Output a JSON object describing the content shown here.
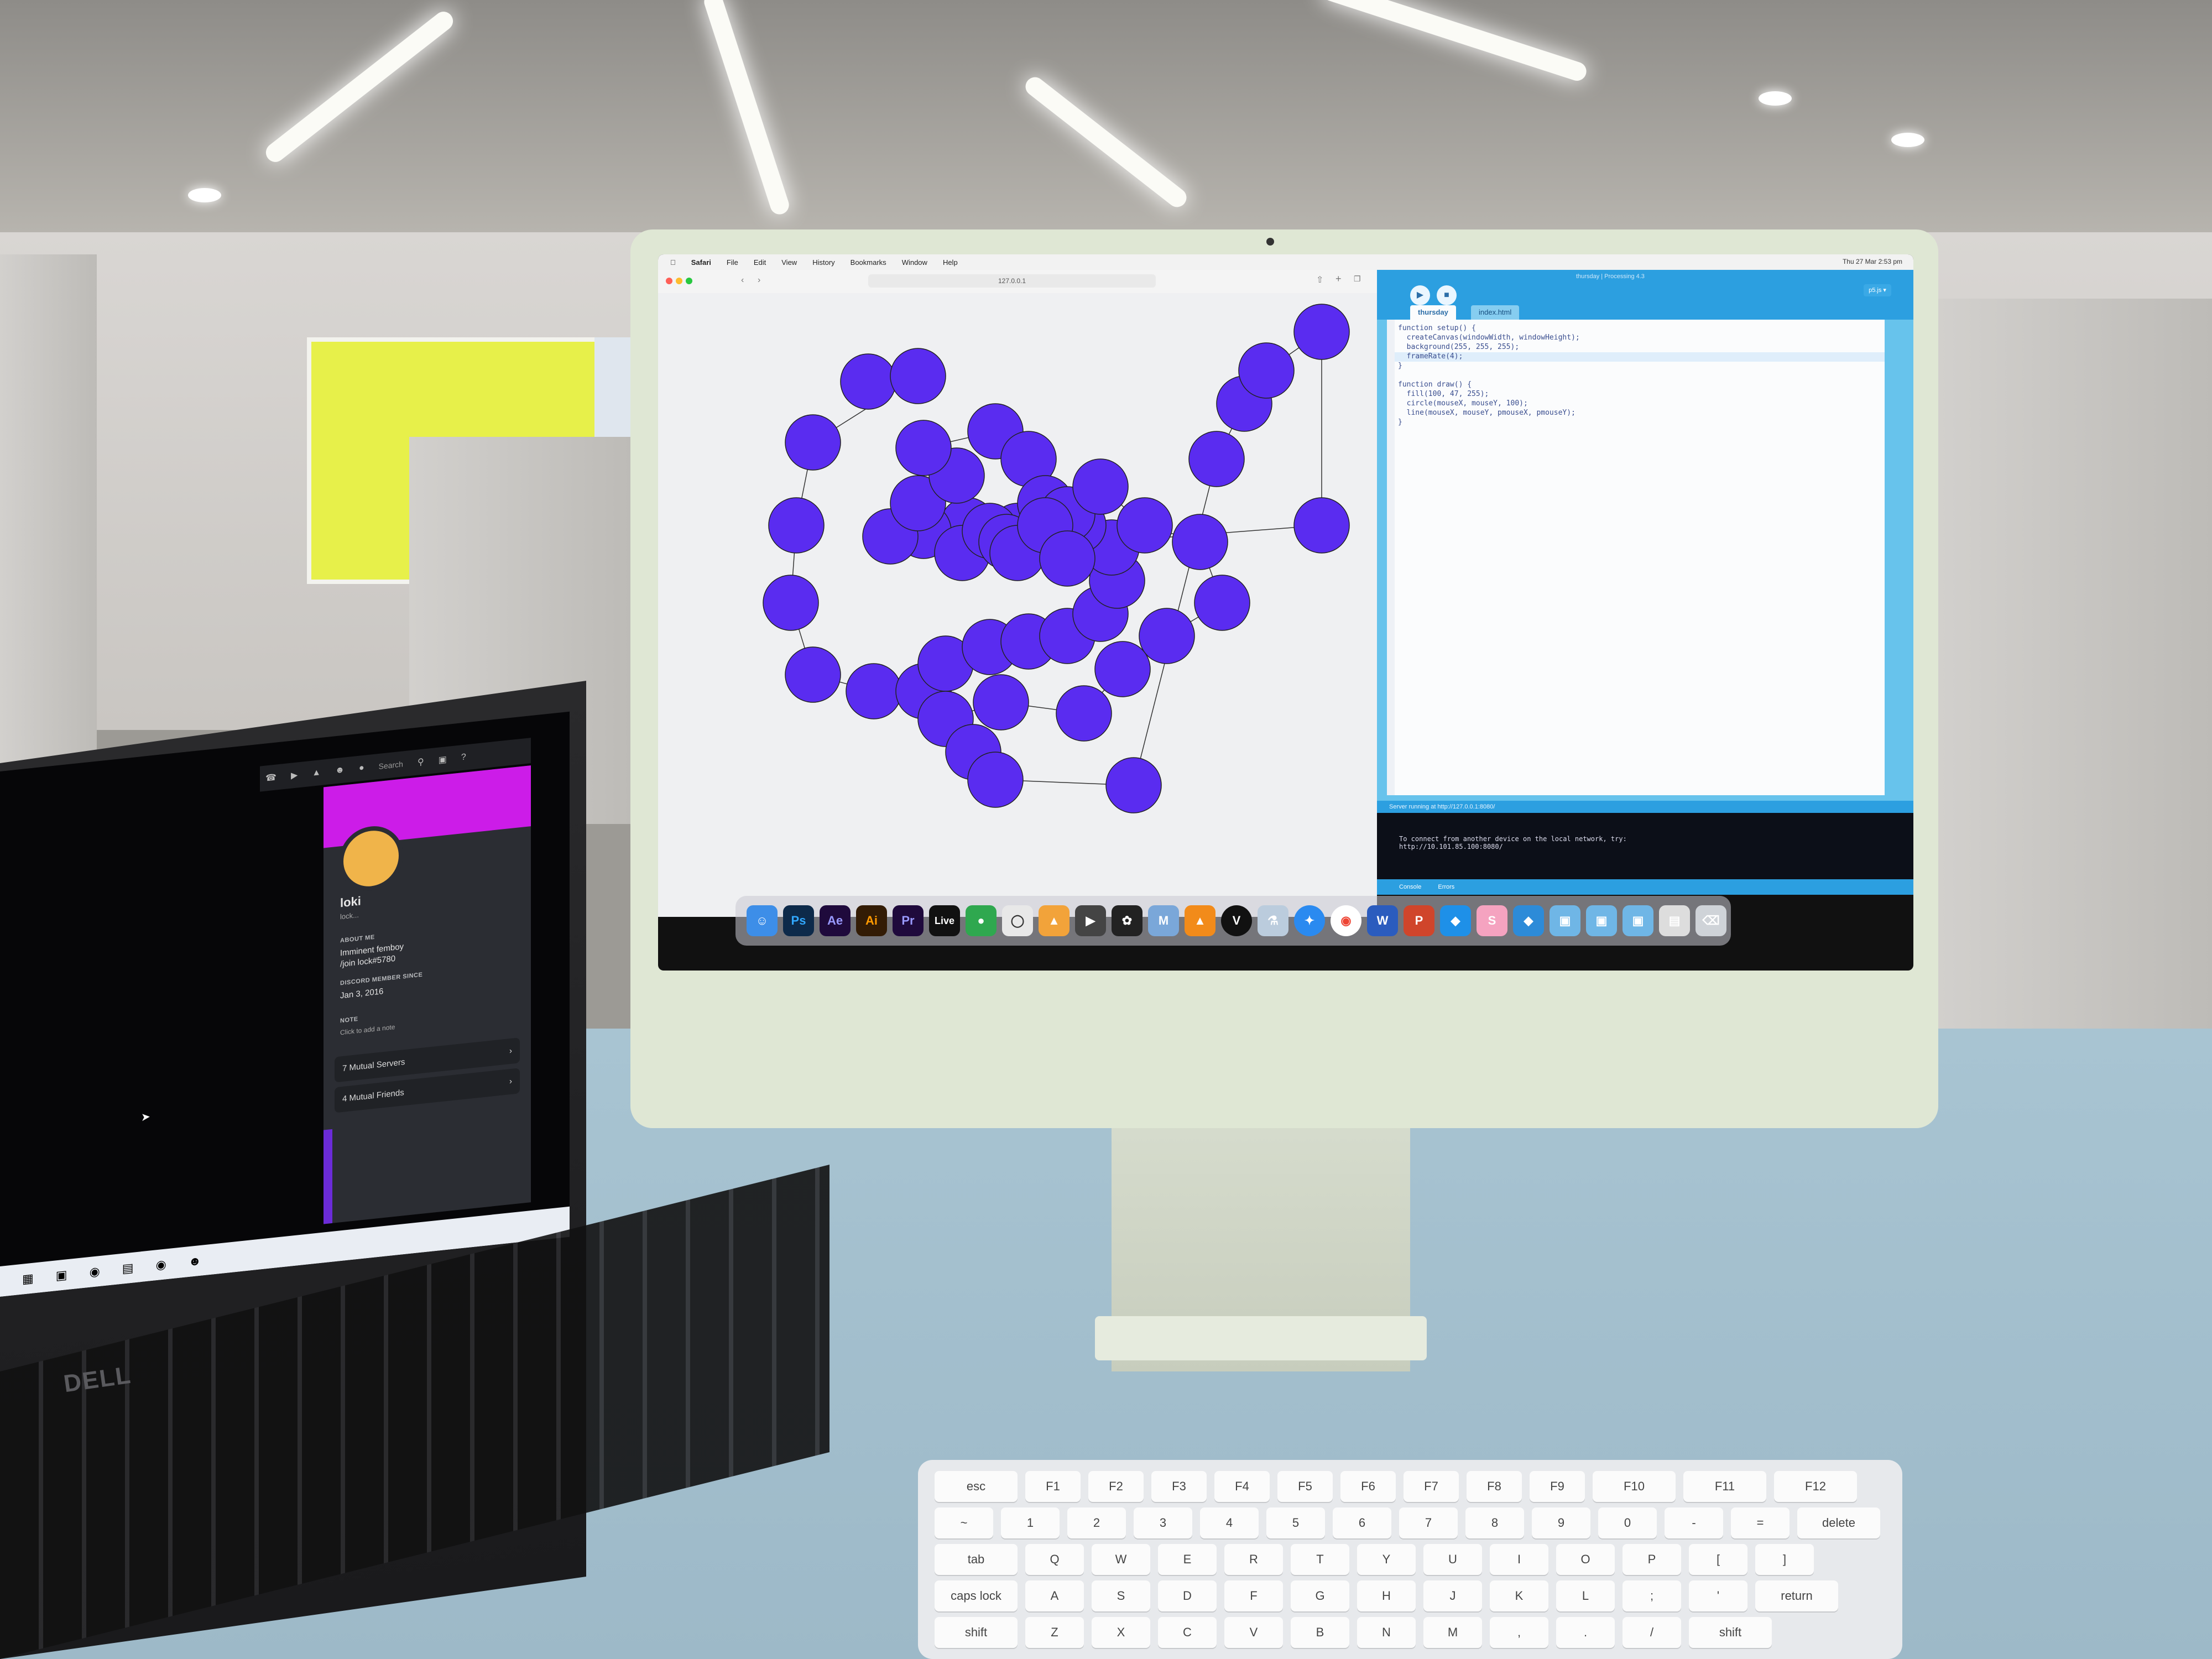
{
  "mac_menubar": {
    "items": [
      "Safari",
      "File",
      "Edit",
      "View",
      "History",
      "Bookmarks",
      "Window",
      "Help"
    ],
    "clock": "Thu 27 Mar  2:53 pm"
  },
  "safari": {
    "address": "127.0.0.1"
  },
  "processing": {
    "window_title": "thursday | Processing 4.3",
    "tabs": [
      "thursday",
      "index.html"
    ],
    "code_lines": [
      "function setup() {",
      "  createCanvas(windowWidth, windowHeight);",
      "  background(255, 255, 255);",
      "  frameRate(4);",
      "}",
      "",
      "function draw() {",
      "  fill(100, 47, 255);",
      "  circle(mouseX, mouseY, 100);",
      "  line(mouseX, mouseY, pmouseX, pmouseY);",
      "}"
    ],
    "status": "Server running at http://127.0.0.1:8080/",
    "console_lines": [
      "To connect from another device on the local network, try:",
      "http://10.101.85.100:8080/"
    ],
    "console_tabs": [
      "Console",
      "Errors"
    ],
    "accent": "#2c9fe0",
    "circle_fill": "#5a2cf0"
  },
  "dock": {
    "labeled_icons": [
      "Ps",
      "Ae",
      "Ai",
      "Pr",
      "Live"
    ]
  },
  "discord": {
    "search_placeholder": "Search",
    "username": "loki",
    "subtitle": "lock...",
    "about_heading": "ABOUT ME",
    "about_lines": [
      "Imminent femboy",
      "/join lock#5780"
    ],
    "member_since_heading": "DISCORD MEMBER SINCE",
    "member_since": "Jan 3, 2016",
    "note_heading": "NOTE",
    "note_placeholder": "Click to add a note",
    "mutual_servers": "7 Mutual Servers",
    "mutual_friends": "4 Mutual Friends",
    "banner_color": "#cc1ce8"
  },
  "laptop": {
    "brand": "DELL"
  },
  "keyboard": {
    "row1": [
      "esc",
      "F1",
      "F2",
      "F3",
      "F4",
      "F5",
      "F6",
      "F7",
      "F8",
      "F9",
      "F10",
      "F11",
      "F12"
    ],
    "row2": [
      "~",
      "1",
      "2",
      "3",
      "4",
      "5",
      "6",
      "7",
      "8",
      "9",
      "0",
      "-",
      "=",
      "delete"
    ],
    "row3": [
      "tab",
      "Q",
      "W",
      "E",
      "R",
      "T",
      "Y",
      "U",
      "I",
      "O",
      "P",
      "[",
      "]"
    ],
    "row4": [
      "caps lock",
      "A",
      "S",
      "D",
      "F",
      "G",
      "H",
      "J",
      "K",
      "L",
      ";",
      "'",
      "return"
    ],
    "row5": [
      "shift",
      "Z",
      "X",
      "C",
      "V",
      "B",
      "N",
      "M",
      ",",
      ".",
      "/",
      "shift"
    ]
  }
}
